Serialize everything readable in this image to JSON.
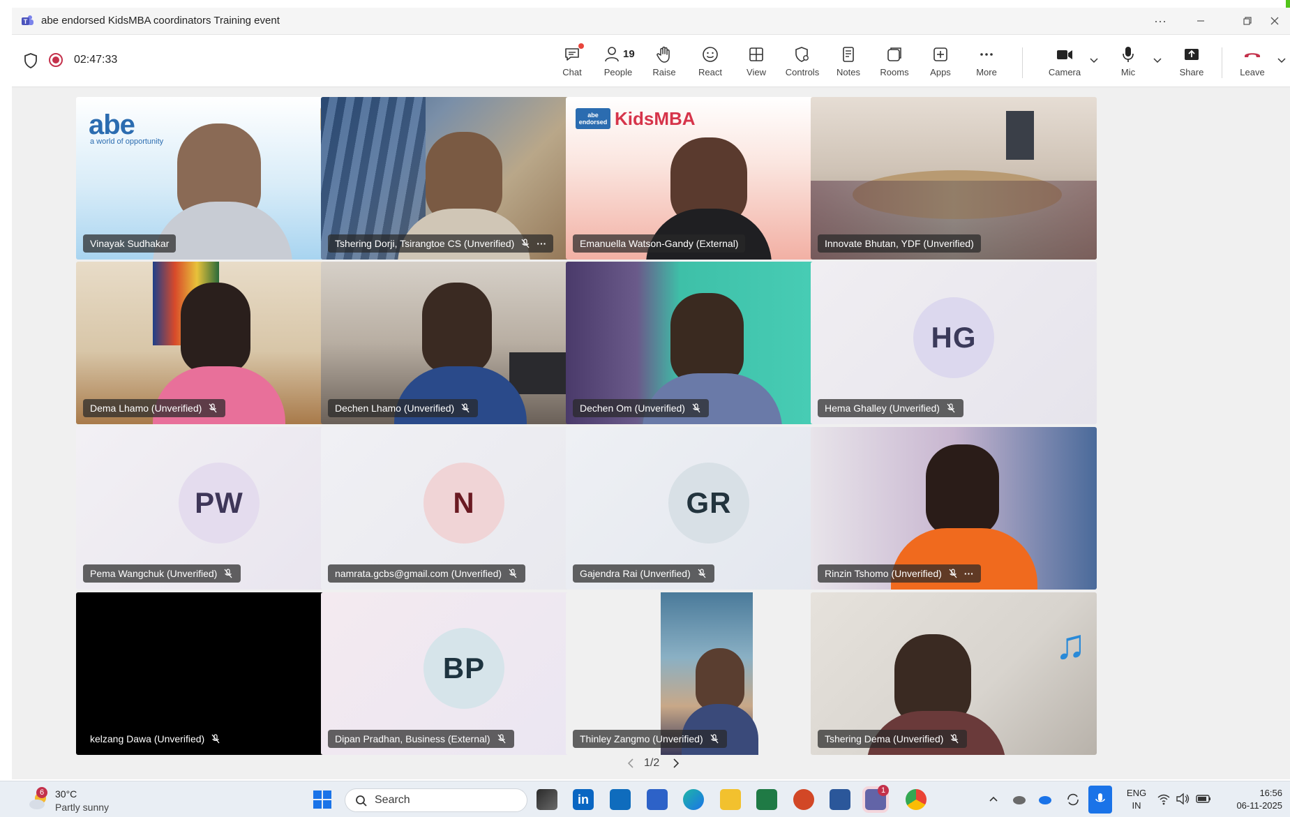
{
  "window": {
    "title": "abe endorsed KidsMBA coordinators Training event"
  },
  "meeting": {
    "timer": "02:47:33"
  },
  "toolbar": {
    "chat": "Chat",
    "people": "People",
    "people_count": "19",
    "raise": "Raise",
    "react": "React",
    "view": "View",
    "controls": "Controls",
    "notes": "Notes",
    "rooms": "Rooms",
    "apps": "Apps",
    "more": "More",
    "camera": "Camera",
    "mic": "Mic",
    "share": "Share",
    "leave": "Leave"
  },
  "participants": [
    {
      "name": "Vinayak Sudhakar",
      "muted": false,
      "video": true
    },
    {
      "name": "Tshering Dorji, Tsirangtoe CS (Unverified)",
      "muted": true,
      "video": true
    },
    {
      "name": "Emanuella Watson-Gandy (External)",
      "muted": false,
      "video": true
    },
    {
      "name": "Innovate Bhutan, YDF (Unverified)",
      "muted": false,
      "video": true
    },
    {
      "name": "Dema Lhamo (Unverified)",
      "muted": true,
      "video": true
    },
    {
      "name": "Dechen Lhamo (Unverified)",
      "muted": true,
      "video": true
    },
    {
      "name": "Dechen Om (Unverified)",
      "muted": true,
      "video": true
    },
    {
      "name": "Hema Ghalley (Unverified)",
      "muted": true,
      "video": false,
      "initials": "HG"
    },
    {
      "name": "Pema Wangchuk (Unverified)",
      "muted": true,
      "video": false,
      "initials": "PW"
    },
    {
      "name": "namrata.gcbs@gmail.com (Unverified)",
      "muted": true,
      "video": false,
      "initials": "N"
    },
    {
      "name": "Gajendra Rai (Unverified)",
      "muted": true,
      "video": false,
      "initials": "GR"
    },
    {
      "name": "Rinzin Tshomo (Unverified)",
      "muted": true,
      "video": true
    },
    {
      "name": "kelzang Dawa (Unverified)",
      "muted": true,
      "video": false
    },
    {
      "name": "Dipan Pradhan, Business (External)",
      "muted": true,
      "video": false,
      "initials": "BP"
    },
    {
      "name": "Thinley Zangmo (Unverified)",
      "muted": true,
      "video": true
    },
    {
      "name": "Tshering Dema (Unverified)",
      "muted": true,
      "video": true
    }
  ],
  "backgrounds": {
    "abe_brand": "abe",
    "abe_tagline": "a world of opportunity",
    "kidsmba_brand_small": "abe endorsed",
    "kidsmba_brand": "KidsMBA"
  },
  "pager": {
    "text": "1/2"
  },
  "taskbar": {
    "weather_temp": "30°C",
    "weather_desc": "Partly sunny",
    "weather_badge": "6",
    "search": "Search",
    "teams_badge": "1",
    "lang_top": "ENG",
    "lang_bottom": "IN",
    "time": "16:56",
    "date": "06-11-2025"
  }
}
